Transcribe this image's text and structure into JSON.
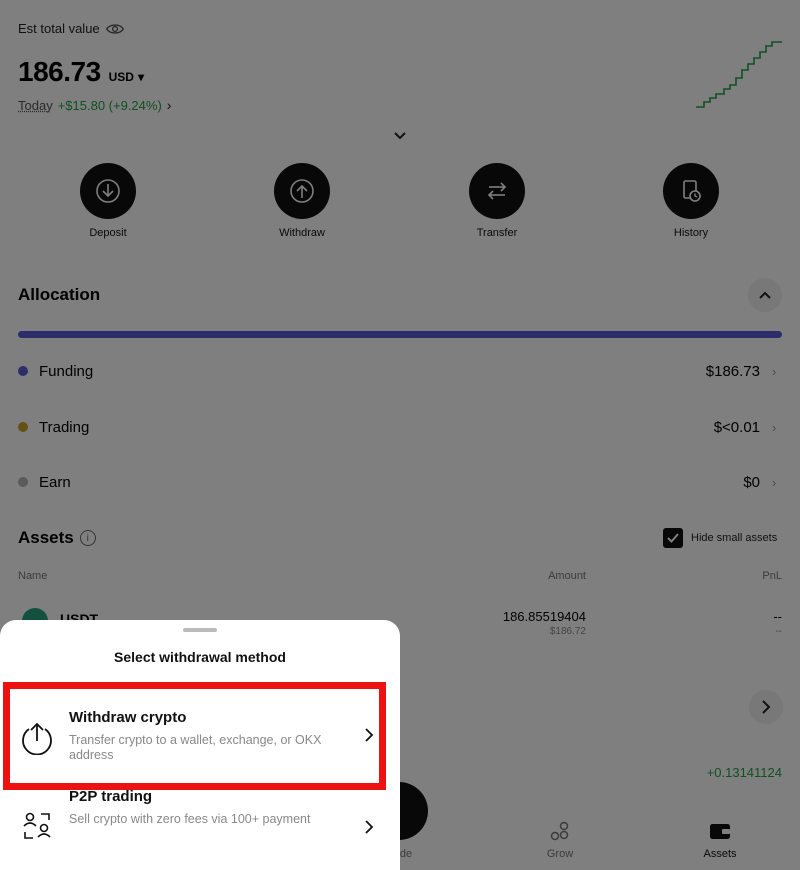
{
  "summary": {
    "est_label": "Est total value",
    "total": "186.73",
    "currency": "USD",
    "today_label": "Today",
    "today_change": "+$15.80 (+9.24%)"
  },
  "actions": [
    {
      "label": "Deposit",
      "icon": "deposit-icon"
    },
    {
      "label": "Withdraw",
      "icon": "withdraw-icon"
    },
    {
      "label": "Transfer",
      "icon": "transfer-icon"
    },
    {
      "label": "History",
      "icon": "history-icon"
    }
  ],
  "allocation": {
    "title": "Allocation",
    "rows": [
      {
        "name": "Funding",
        "value": "$186.73",
        "color": "#5a5bd6"
      },
      {
        "name": "Trading",
        "value": "$<0.01",
        "color": "#c9a227"
      },
      {
        "name": "Earn",
        "value": "$0",
        "color": "#b5b5b5"
      }
    ]
  },
  "assets": {
    "title": "Assets",
    "hide_small_label": "Hide small assets",
    "hide_small_checked": true,
    "columns": {
      "name": "Name",
      "amount": "Amount",
      "pnl": "PnL"
    },
    "rows": [
      {
        "coin": "USDT",
        "amount": "186.85519404",
        "amount_usd": "$186.72",
        "pnl": "--",
        "pnl_sub": "--"
      }
    ],
    "pnl_green": "+0.13141124"
  },
  "nav": {
    "trade_label": "ade",
    "grow_label": "Grow",
    "assets_label": "Assets"
  },
  "sheet": {
    "title": "Select withdrawal method",
    "methods": [
      {
        "title": "Withdraw crypto",
        "desc": "Transfer crypto to a wallet, exchange, or OKX address",
        "icon": "withdraw-crypto-icon",
        "highlighted": true
      },
      {
        "title": "P2P trading",
        "desc": "Sell crypto with zero fees via 100+ payment",
        "icon": "p2p-trading-icon",
        "highlighted": false
      }
    ]
  },
  "colors": {
    "accent_green": "#21a04a",
    "highlight_red": "#ee1111",
    "allocation_bar": "#5a5bd6"
  }
}
